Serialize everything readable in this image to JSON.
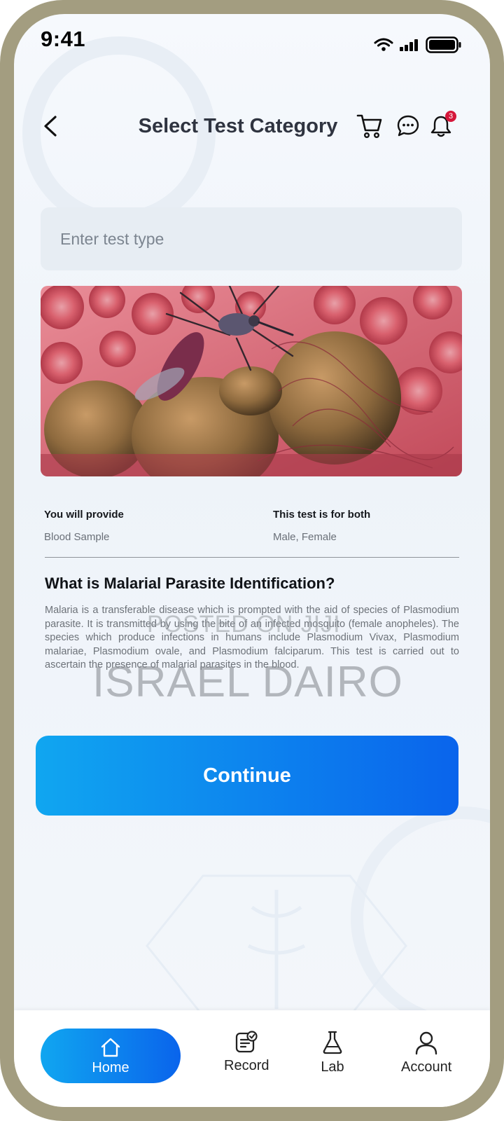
{
  "status_bar": {
    "time": "9:41"
  },
  "header": {
    "title": "Select Test Category",
    "notification_count": "3"
  },
  "search": {
    "placeholder": "Enter test type"
  },
  "info": {
    "provide_label": "You will provide",
    "provide_value": "Blood Sample",
    "for_label": "This test is for both",
    "for_value": "Male, Female"
  },
  "section": {
    "title": "What is Malarial Parasite Identification?",
    "description": "Malaria is a transferable disease which is prompted with the aid of species of Plasmodium parasite. It is transmitted by using the bite of an infected mosquito (female anopheles). The species which produce infections in humans include Plasmodium Vivax, Plasmodium malariae, Plasmodium ovale, and Plasmodium falciparum. This test is carried out to ascertain the presence of malarial parasites in the blood."
  },
  "watermark": {
    "line1": "POSTED ON JIJI",
    "line2": "ISRAEL DAIRO"
  },
  "continue_label": "Continue",
  "nav": {
    "items": [
      {
        "label": "Home",
        "icon": "home-icon",
        "active": true
      },
      {
        "label": "Record",
        "icon": "record-icon",
        "active": false
      },
      {
        "label": "Lab",
        "icon": "flask-icon",
        "active": false
      },
      {
        "label": "Account",
        "icon": "user-icon",
        "active": false
      }
    ]
  },
  "colors": {
    "accent_start": "#10a6f0",
    "accent_end": "#0a64ec",
    "badge": "#d5173a"
  }
}
